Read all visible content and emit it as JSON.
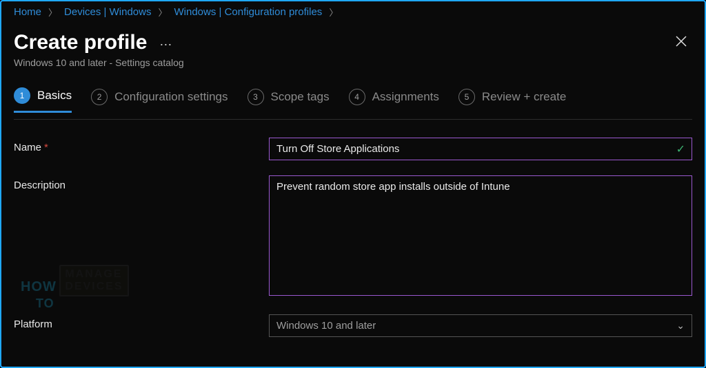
{
  "breadcrumb": {
    "items": [
      {
        "label": "Home"
      },
      {
        "label": "Devices | Windows"
      },
      {
        "label": "Windows | Configuration profiles"
      }
    ]
  },
  "header": {
    "title": "Create profile",
    "subtitle": "Windows 10 and later - Settings catalog"
  },
  "steps": [
    {
      "num": "1",
      "label": "Basics",
      "active": true
    },
    {
      "num": "2",
      "label": "Configuration settings",
      "active": false
    },
    {
      "num": "3",
      "label": "Scope tags",
      "active": false
    },
    {
      "num": "4",
      "label": "Assignments",
      "active": false
    },
    {
      "num": "5",
      "label": "Review + create",
      "active": false
    }
  ],
  "form": {
    "name_label": "Name",
    "name_value": "Turn Off Store Applications",
    "description_label": "Description",
    "description_value": "Prevent random store app installs outside of Intune",
    "platform_label": "Platform",
    "platform_value": "Windows 10 and later"
  },
  "watermark": {
    "how": "HOW",
    "to": "TO",
    "line1": "MANAGE",
    "line2": "DEVICES"
  }
}
